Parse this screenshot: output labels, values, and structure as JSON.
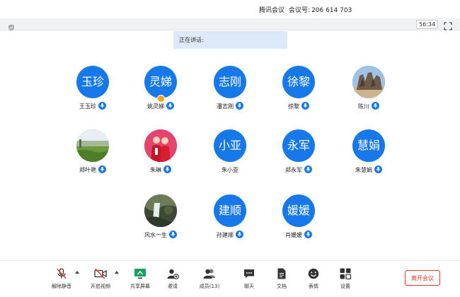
{
  "window": {
    "app_name": "腾讯会议",
    "meeting_id_label": "会议号:",
    "meeting_id": "206 614 703"
  },
  "topbar": {
    "timer": "56:34"
  },
  "speaking": {
    "label": "正在讲话:"
  },
  "participants": [
    {
      "name": "王玉珍",
      "avatar_text": "玉珍",
      "avatar_type": "text"
    },
    {
      "name": "姚灵娣",
      "avatar_text": "灵娣",
      "avatar_type": "text",
      "hand_raised": true
    },
    {
      "name": "潘志刚",
      "avatar_text": "志刚",
      "avatar_type": "text"
    },
    {
      "name": "徐黎",
      "avatar_text": "徐黎",
      "avatar_type": "text"
    },
    {
      "name": "陈川",
      "avatar_text": "",
      "avatar_type": "photo-rocks"
    },
    {
      "name": "郑叶艳",
      "avatar_text": "",
      "avatar_type": "photo-field"
    },
    {
      "name": "朱琳",
      "avatar_text": "",
      "avatar_type": "photo-people"
    },
    {
      "name": "朱小亚",
      "avatar_text": "小亚",
      "avatar_type": "text",
      "no_mic": true
    },
    {
      "name": "郑永军",
      "avatar_text": "永军",
      "avatar_type": "text"
    },
    {
      "name": "朱慧娟",
      "avatar_text": "慧娟",
      "avatar_type": "text"
    },
    {
      "name": "风水一生",
      "avatar_text": "",
      "avatar_type": "photo-waterfall"
    },
    {
      "name": "孙建顺",
      "avatar_text": "建顺",
      "avatar_type": "text"
    },
    {
      "name": "肖媛媛",
      "avatar_text": "媛媛",
      "avatar_type": "text"
    }
  ],
  "toolbar": {
    "unmute": "解除静音",
    "start_video": "开启视频",
    "share_screen": "共享屏幕",
    "invite": "邀请",
    "members": "成员(13)",
    "chat": "聊天",
    "docs": "文档",
    "reactions": "表情",
    "settings": "设置",
    "leave": "离开会议"
  },
  "colors": {
    "accent": "#1778ea",
    "leave": "#e5342b",
    "share": "#19a15f"
  }
}
